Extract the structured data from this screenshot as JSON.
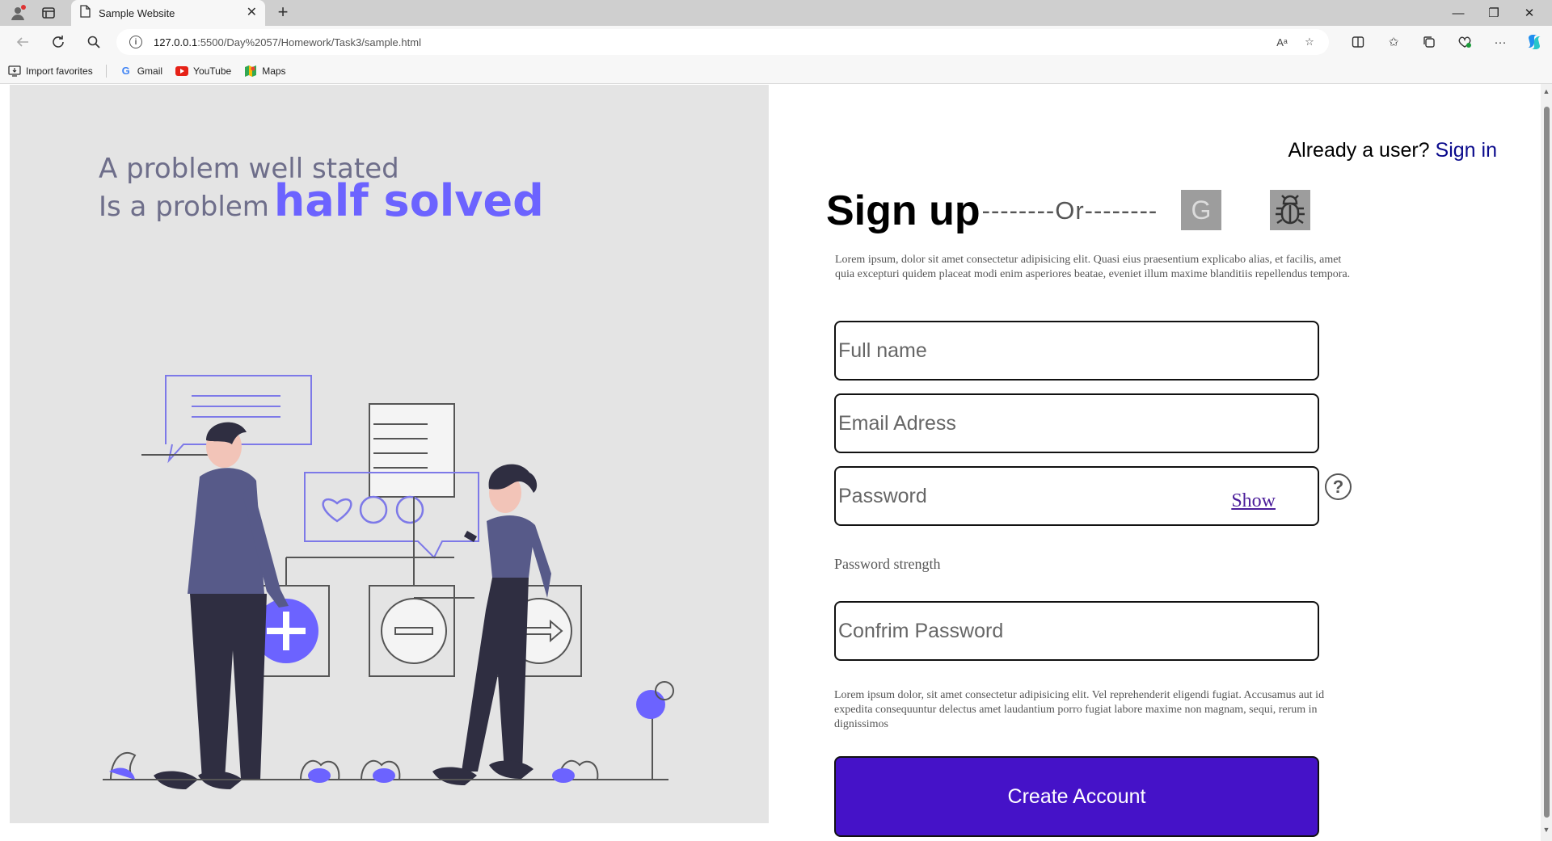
{
  "browser": {
    "tab_title": "Sample Website",
    "url_host": "127.0.0.1",
    "url_path": ":5500/Day%2057/Homework/Task3/sample.html",
    "bookmarks": [
      "Import favorites",
      "Gmail",
      "YouTube",
      "Maps"
    ]
  },
  "hero": {
    "line1": "A problem well stated",
    "line2": "Is a problem",
    "highlight": "half solved"
  },
  "header": {
    "already_text": "Already a user?",
    "sign_in": "Sign in"
  },
  "signup": {
    "title": "Sign up",
    "or_text": "--------Or--------",
    "google_letter": "G",
    "intro": "Lorem ipsum, dolor sit amet consectetur adipisicing elit. Quasi eius praesentium explicabo alias, et facilis, amet quia excepturi quidem placeat modi enim asperiores beatae, eveniet illum maxime blanditiis repellendus tempora."
  },
  "form": {
    "full_name_placeholder": "Full name",
    "email_placeholder": "Email Adress",
    "password_placeholder": "Password",
    "show_label": "Show",
    "help_symbol": "?",
    "password_strength": "Password strength",
    "confirm_placeholder": "Confrim Password",
    "terms": "Lorem ipsum dolor, sit amet consectetur adipisicing elit. Vel reprehenderit eligendi fugiat. Accusamus aut id expedita consequuntur delectus amet laudantium porro fugiat labore maxime non magnam, sequi, rerum in dignissimos",
    "submit_label": "Create Account"
  },
  "colors": {
    "accent": "#4512c8",
    "illustration": "#6c63ff",
    "sign_in_link": "#0a0a8c"
  }
}
